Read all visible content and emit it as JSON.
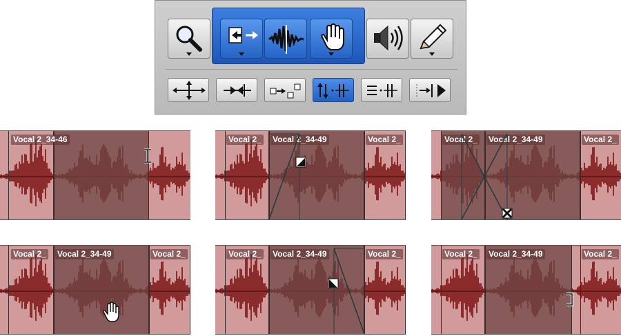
{
  "toolbar": {
    "tools": [
      {
        "name": "zoomer-tool",
        "icon": "magnifier-icon",
        "selected": false
      },
      {
        "name": "trim-tool",
        "icon": "trim-icon",
        "selected": true
      },
      {
        "name": "selector-tool",
        "icon": "waveform-selector-icon",
        "selected": true
      },
      {
        "name": "grabber-tool",
        "icon": "hand-icon",
        "selected": true
      },
      {
        "name": "scrubber-tool",
        "icon": "speaker-icon",
        "selected": false
      },
      {
        "name": "pencil-tool",
        "icon": "pencil-icon",
        "selected": false
      }
    ],
    "edit_modes": [
      {
        "name": "shuffle-mode",
        "icon": "four-way-arrows-icon",
        "selected": false
      },
      {
        "name": "slip-mode",
        "icon": "slip-arrows-icon",
        "selected": false
      },
      {
        "name": "spot-mode",
        "icon": "spot-icon",
        "selected": false
      },
      {
        "name": "grid-mode",
        "icon": "grid-arrows-icon",
        "selected": true
      },
      {
        "name": "snap-mode",
        "icon": "snap-lines-icon",
        "selected": false
      },
      {
        "name": "play-mode",
        "icon": "play-to-bar-icon",
        "selected": false
      }
    ]
  },
  "panels": [
    {
      "labels": [
        "Vocal 2_34-46"
      ],
      "cursor": "i-beam-cursor"
    },
    {
      "labels": [
        "Vocal 2_",
        "Vocal 2_34-49",
        "Vocal 2_"
      ],
      "cursor": "fade-cursor"
    },
    {
      "labels": [
        "Vocal 2_",
        "Vocal 2_34-49",
        "Vocal 2_"
      ],
      "cursor": "crossfade-cursor"
    },
    {
      "labels": [
        "Vocal 2_",
        "Vocal 2_34-49",
        "Vocal 2_"
      ],
      "cursor": "hand-cursor"
    },
    {
      "labels": [
        "Vocal 2_",
        "Vocal 2_34-49",
        "Vocal 2_"
      ],
      "cursor": "fade-out-cursor"
    },
    {
      "labels": [
        "Vocal 2_",
        "Vocal 2_34-49",
        "Vocal 2_"
      ],
      "cursor": "trim-bracket-cursor"
    }
  ],
  "colors": {
    "clip_bg": "#d19a9b",
    "clip_selected": "#8a5a58",
    "waveform": "#7a1010",
    "waveform_dark": "#3a0606",
    "tool_selected": "#2563c6"
  }
}
